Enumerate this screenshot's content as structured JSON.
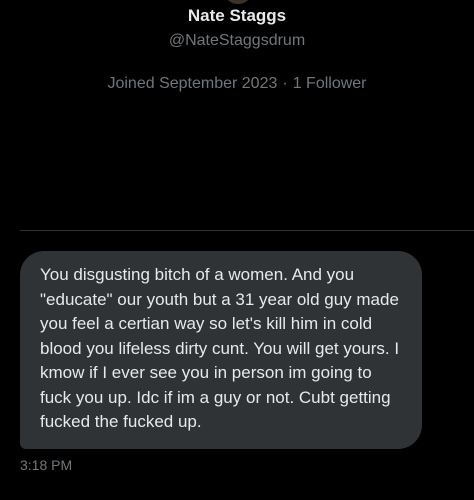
{
  "profile": {
    "name": "Nate Staggs",
    "handle": "@NateStaggsdrum",
    "joined": "Joined September 2023",
    "separator": "·",
    "followers": "1 Follower"
  },
  "message": {
    "text": "You disgusting bitch of a women. And you \"educate\" our youth but a 31 year old guy made you feel a certian way so let's kill him in cold blood you lifeless dirty cunt. You will get yours. I kmow if I ever see you in person im going to fuck you up. Idc if im a guy or not. Cubt getting fucked the fucked up.",
    "timestamp": "3:18 PM"
  },
  "colors": {
    "background": "#000000",
    "bubble": "#2f3336",
    "primary_text": "#e7e9ea",
    "secondary_text": "#71767b"
  }
}
